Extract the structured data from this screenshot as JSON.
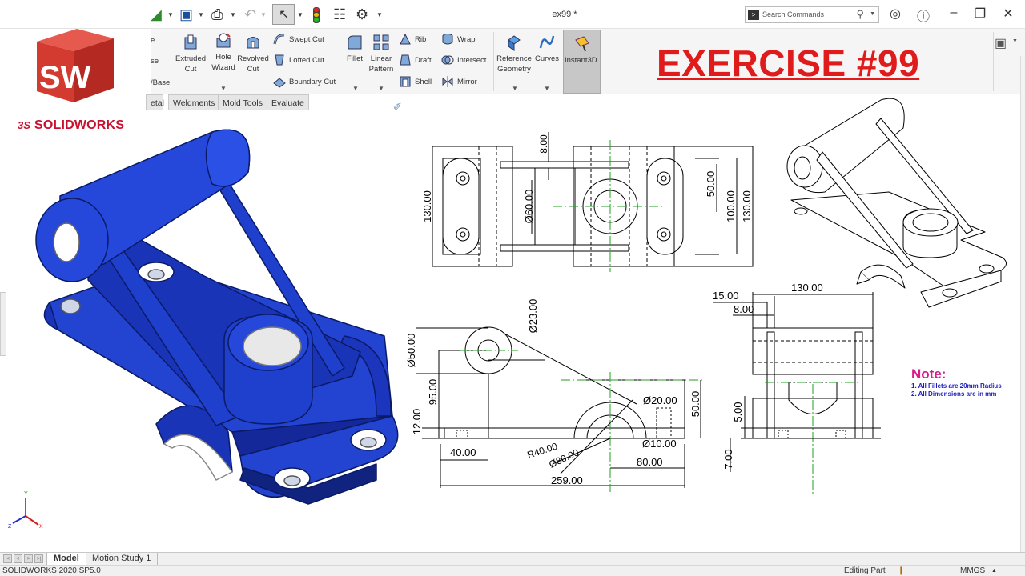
{
  "window": {
    "title": "ex99 *",
    "search_placeholder": "Search Commands"
  },
  "ribbon": {
    "extruded_cut": "Extruded Cut",
    "hole_wizard": "Hole Wizard",
    "revolved_cut": "Revolved Cut",
    "swept_cut": "Swept Cut",
    "lofted_cut": "Lofted Cut",
    "boundary_cut": "Boundary Cut",
    "fillet": "Fillet",
    "linear_pattern": "Linear Pattern",
    "rib": "Rib",
    "draft": "Draft",
    "shell": "Shell",
    "wrap": "Wrap",
    "intersect": "Intersect",
    "mirror": "Mirror",
    "reference_geometry": "Reference Geometry",
    "curves": "Curves",
    "instant3d": "Instant3D",
    "partial_1": "e",
    "partial_2": "se",
    "partial_3": "/Base"
  },
  "command_tabs": [
    "etal",
    "Weldments",
    "Mold Tools",
    "Evaluate"
  ],
  "logo": {
    "letters": "SW",
    "brand": "SOLIDWORKS",
    "brand_prefix": "3S"
  },
  "heading": "EXERCISE #99",
  "dimensions": {
    "top_view": [
      "8.00",
      "130.00",
      "Ø60.00",
      "50.00",
      "100.00",
      "130.00"
    ],
    "front_view": [
      "Ø50.00",
      "Ø23.00",
      "95.00",
      "12.00",
      "Ø20.00",
      "50.00",
      "40.00",
      "R40.00",
      "Ø80.00",
      "Ø10.00",
      "80.00",
      "259.00"
    ],
    "side_view": [
      "15.00",
      "8.00",
      "130.00",
      "5.00",
      "7.00"
    ]
  },
  "note": {
    "heading": "Note:",
    "lines": [
      "1. All Fillets are 20mm Radius",
      "2. All Dimensions are in mm"
    ]
  },
  "bottom_tabs": [
    "Model",
    "Motion Study 1"
  ],
  "status": {
    "version": "SOLIDWORKS 2020 SP5.0",
    "mode": "Editing Part",
    "units": "MMGS"
  },
  "triad_labels": [
    "Y",
    "X",
    "Z"
  ],
  "colors": {
    "part_blue": "#1f3fc9",
    "heading_red": "#e01b1b",
    "note_pink": "#d81b8a",
    "note_blue": "#1b1bbf",
    "centerline_green": "#1aa31a",
    "logo_red": "#c8102e"
  }
}
